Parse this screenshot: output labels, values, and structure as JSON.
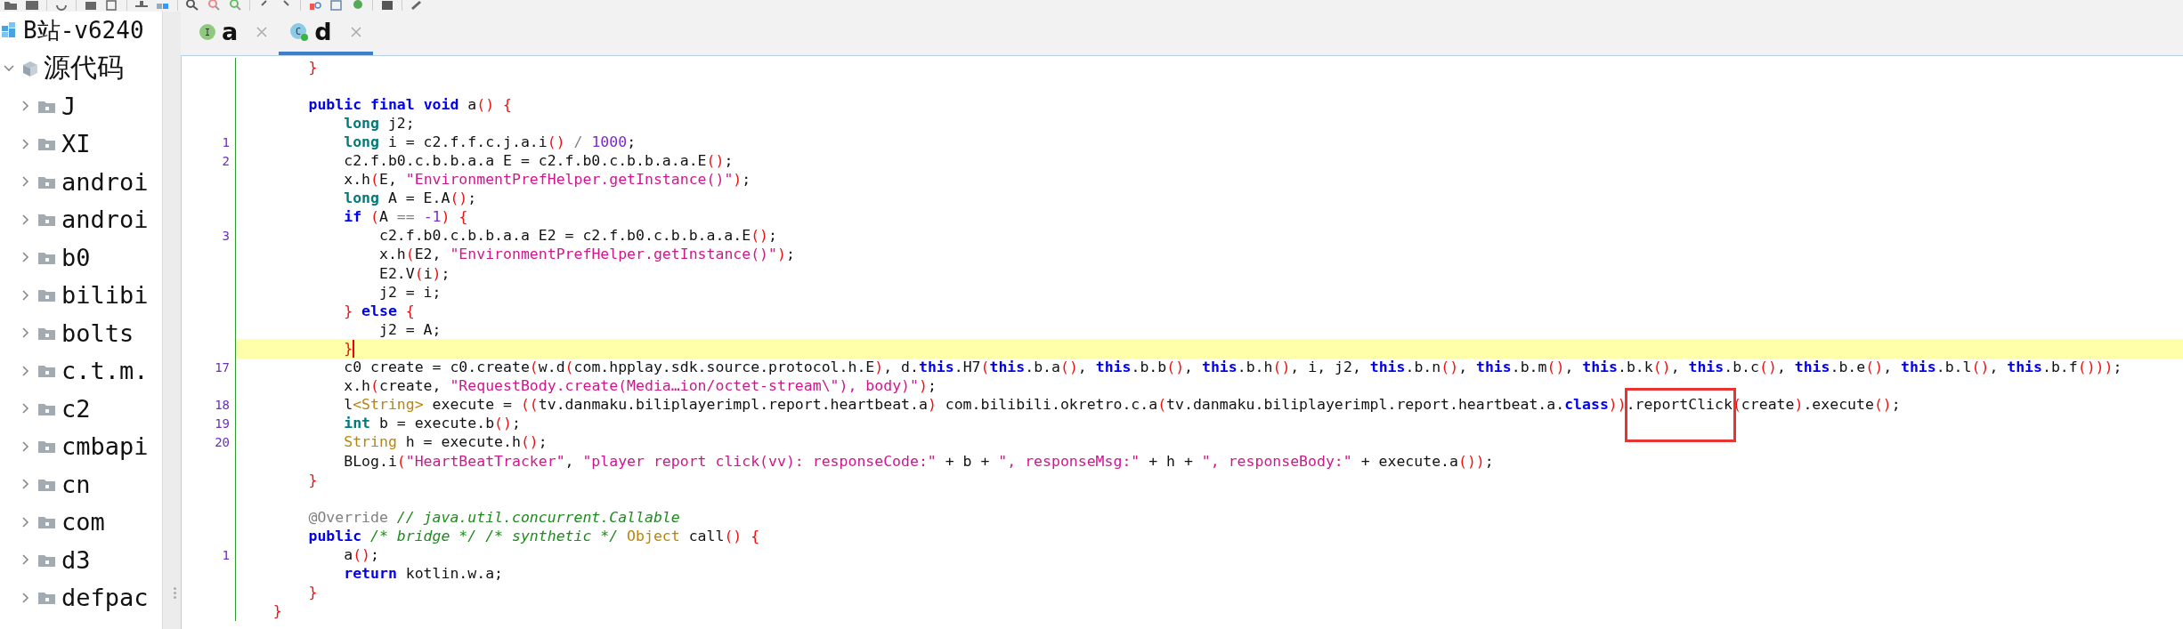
{
  "project_tree": {
    "label": "B站-v6240",
    "children": [
      {
        "label": "源代码",
        "expanded": true,
        "children": [
          {
            "label": "J",
            "expanded": false
          },
          {
            "label": "XI",
            "expanded": false
          },
          {
            "label": "androi",
            "expanded": false
          },
          {
            "label": "androi",
            "expanded": false
          },
          {
            "label": "b0",
            "expanded": false
          },
          {
            "label": "bilibi",
            "expanded": false
          },
          {
            "label": "bolts",
            "expanded": false
          },
          {
            "label": "c.t.m.",
            "expanded": false
          },
          {
            "label": "c2",
            "expanded": false
          },
          {
            "label": "cmbapi",
            "expanded": false
          },
          {
            "label": "cn",
            "expanded": false
          },
          {
            "label": "com",
            "expanded": false
          },
          {
            "label": "d3",
            "expanded": false
          },
          {
            "label": "defpac",
            "expanded": false
          }
        ]
      }
    ]
  },
  "tabs": [
    {
      "label": "a",
      "kind": "interface",
      "icon_letter": "I",
      "selected": false
    },
    {
      "label": "d",
      "kind": "class",
      "icon_letter": "C",
      "selected": true
    }
  ],
  "editor": {
    "lines": [
      {
        "tokens": [
          {
            "kind": "punc",
            "text": "        }"
          }
        ]
      },
      {
        "blank_line_before": true,
        "tokens": [
          {
            "kind": "kw",
            "text": "        public "
          },
          {
            "kind": "kw",
            "text": "final "
          },
          {
            "kind": "kw",
            "text": "void"
          },
          {
            "kind": "plain",
            "text": " a"
          },
          {
            "kind": "punc",
            "text": "() {"
          }
        ]
      },
      {
        "tokens": [
          {
            "kind": "type",
            "text": "            long"
          },
          {
            "kind": "plain",
            "text": " j2;"
          }
        ]
      },
      {
        "number": "1",
        "tokens": [
          {
            "kind": "type",
            "text": "            long"
          },
          {
            "kind": "plain",
            "text": " i = c2.f.f.c.j.a.i"
          },
          {
            "kind": "punc",
            "text": "()"
          },
          {
            "kind": "op",
            "text": " / "
          },
          {
            "kind": "num",
            "text": "1000"
          },
          {
            "kind": "plain",
            "text": ";"
          }
        ]
      },
      {
        "number": "2",
        "tokens": [
          {
            "kind": "plain",
            "text": "            c2.f.b0.c.b.b.a.a E = c2.f.b0.c.b.b.a.a.E"
          },
          {
            "kind": "punc",
            "text": "()"
          },
          {
            "kind": "plain",
            "text": ";"
          }
        ]
      },
      {
        "tokens": [
          {
            "kind": "plain",
            "text": "            x.h"
          },
          {
            "kind": "punc",
            "text": "("
          },
          {
            "kind": "plain",
            "text": "E, "
          },
          {
            "kind": "str",
            "text": "\"EnvironmentPrefHelper.getInstance()\""
          },
          {
            "kind": "punc",
            "text": ")"
          },
          {
            "kind": "plain",
            "text": ";"
          }
        ]
      },
      {
        "tokens": [
          {
            "kind": "type",
            "text": "            long"
          },
          {
            "kind": "plain",
            "text": " A = E.A"
          },
          {
            "kind": "punc",
            "text": "()"
          },
          {
            "kind": "plain",
            "text": ";"
          }
        ]
      },
      {
        "tokens": [
          {
            "kind": "kw",
            "text": "            if "
          },
          {
            "kind": "punc",
            "text": "("
          },
          {
            "kind": "plain",
            "text": "A "
          },
          {
            "kind": "op",
            "text": "== "
          },
          {
            "kind": "num",
            "text": "-1"
          },
          {
            "kind": "punc",
            "text": ") {"
          }
        ]
      },
      {
        "number": "3",
        "tokens": [
          {
            "kind": "plain",
            "text": "                c2.f.b0.c.b.b.a.a E2 = c2.f.b0.c.b.b.a.a.E"
          },
          {
            "kind": "punc",
            "text": "()"
          },
          {
            "kind": "plain",
            "text": ";"
          }
        ]
      },
      {
        "tokens": [
          {
            "kind": "plain",
            "text": "                x.h"
          },
          {
            "kind": "punc",
            "text": "("
          },
          {
            "kind": "plain",
            "text": "E2, "
          },
          {
            "kind": "str",
            "text": "\"EnvironmentPrefHelper.getInstance()\""
          },
          {
            "kind": "punc",
            "text": ")"
          },
          {
            "kind": "plain",
            "text": ";"
          }
        ]
      },
      {
        "tokens": [
          {
            "kind": "plain",
            "text": "                E2.V"
          },
          {
            "kind": "punc",
            "text": "("
          },
          {
            "kind": "plain",
            "text": "i"
          },
          {
            "kind": "punc",
            "text": ")"
          },
          {
            "kind": "plain",
            "text": ";"
          }
        ]
      },
      {
        "tokens": [
          {
            "kind": "plain",
            "text": "                j2 = i;"
          }
        ]
      },
      {
        "tokens": [
          {
            "kind": "punc",
            "text": "            } "
          },
          {
            "kind": "kw",
            "text": "else "
          },
          {
            "kind": "punc",
            "text": "{"
          }
        ]
      },
      {
        "tokens": [
          {
            "kind": "plain",
            "text": "                j2 = A;"
          }
        ]
      },
      {
        "current": true,
        "tokens": [
          {
            "kind": "punc",
            "text": "            }"
          }
        ]
      },
      {
        "number": "17",
        "tokens": [
          {
            "kind": "plain",
            "text": "            c0 create = c0.create"
          },
          {
            "kind": "punc",
            "text": "("
          },
          {
            "kind": "plain",
            "text": "w.d"
          },
          {
            "kind": "punc",
            "text": "("
          },
          {
            "kind": "plain",
            "text": "com.hpplay.sdk.source.protocol.h.E"
          },
          {
            "kind": "punc",
            "text": ")"
          },
          {
            "kind": "plain",
            "text": ", d."
          },
          {
            "kind": "kw",
            "text": "this"
          },
          {
            "kind": "plain",
            "text": ".H7"
          },
          {
            "kind": "punc",
            "text": "("
          },
          {
            "kind": "kw",
            "text": "this"
          },
          {
            "kind": "plain",
            "text": ".b.a"
          },
          {
            "kind": "punc",
            "text": "()"
          },
          {
            "kind": "plain",
            "text": ", "
          },
          {
            "kind": "kw",
            "text": "this"
          },
          {
            "kind": "plain",
            "text": ".b.b"
          },
          {
            "kind": "punc",
            "text": "()"
          },
          {
            "kind": "plain",
            "text": ", "
          },
          {
            "kind": "kw",
            "text": "this"
          },
          {
            "kind": "plain",
            "text": ".b.h"
          },
          {
            "kind": "punc",
            "text": "()"
          },
          {
            "kind": "plain",
            "text": ", i, j2, "
          },
          {
            "kind": "kw",
            "text": "this"
          },
          {
            "kind": "plain",
            "text": ".b.n"
          },
          {
            "kind": "punc",
            "text": "()"
          },
          {
            "kind": "plain",
            "text": ", "
          },
          {
            "kind": "kw",
            "text": "this"
          },
          {
            "kind": "plain",
            "text": ".b.m"
          },
          {
            "kind": "punc",
            "text": "()"
          },
          {
            "kind": "plain",
            "text": ", "
          },
          {
            "kind": "kw",
            "text": "this"
          },
          {
            "kind": "plain",
            "text": ".b.k"
          },
          {
            "kind": "punc",
            "text": "()"
          },
          {
            "kind": "plain",
            "text": ", "
          },
          {
            "kind": "kw",
            "text": "this"
          },
          {
            "kind": "plain",
            "text": ".b.c"
          },
          {
            "kind": "punc",
            "text": "()"
          },
          {
            "kind": "plain",
            "text": ", "
          },
          {
            "kind": "kw",
            "text": "this"
          },
          {
            "kind": "plain",
            "text": ".b.e"
          },
          {
            "kind": "punc",
            "text": "()"
          },
          {
            "kind": "plain",
            "text": ", "
          },
          {
            "kind": "kw",
            "text": "this"
          },
          {
            "kind": "plain",
            "text": ".b.l"
          },
          {
            "kind": "punc",
            "text": "()"
          },
          {
            "kind": "plain",
            "text": ", "
          },
          {
            "kind": "kw",
            "text": "this"
          },
          {
            "kind": "plain",
            "text": ".b.f"
          },
          {
            "kind": "punc",
            "text": "()))"
          },
          {
            "kind": "plain",
            "text": ";"
          }
        ]
      },
      {
        "tokens": [
          {
            "kind": "plain",
            "text": "            x.h"
          },
          {
            "kind": "punc",
            "text": "("
          },
          {
            "kind": "plain",
            "text": "create, "
          },
          {
            "kind": "str",
            "text": "\"RequestBody.create(Media…ion/octet-stream\\\"), body)\""
          },
          {
            "kind": "punc",
            "text": ")"
          },
          {
            "kind": "plain",
            "text": ";"
          }
        ]
      },
      {
        "number": "18",
        "tokens": [
          {
            "kind": "plain",
            "text": "            l"
          },
          {
            "kind": "cls",
            "text": "<String>"
          },
          {
            "kind": "plain",
            "text": " execute = "
          },
          {
            "kind": "punc",
            "text": "(("
          },
          {
            "kind": "plain",
            "text": "tv.danmaku.biliplayerimpl.report.heartbeat.a"
          },
          {
            "kind": "punc",
            "text": ")"
          },
          {
            "kind": "plain",
            "text": " com.bilibili.okretro.c.a"
          },
          {
            "kind": "punc",
            "text": "("
          },
          {
            "kind": "plain",
            "text": "tv.danmaku.biliplayerimpl.report.heartbeat.a."
          },
          {
            "kind": "kw",
            "text": "class"
          },
          {
            "kind": "punc",
            "text": "))"
          },
          {
            "kind": "plain",
            "text": ".reportClick",
            "boxed": true
          },
          {
            "kind": "punc",
            "text": "("
          },
          {
            "kind": "plain",
            "text": "create"
          },
          {
            "kind": "punc",
            "text": ")"
          },
          {
            "kind": "plain",
            "text": ".execute"
          },
          {
            "kind": "punc",
            "text": "()"
          },
          {
            "kind": "plain",
            "text": ";"
          }
        ]
      },
      {
        "number": "19",
        "tokens": [
          {
            "kind": "type",
            "text": "            int"
          },
          {
            "kind": "plain",
            "text": " b = execute.b"
          },
          {
            "kind": "punc",
            "text": "()"
          },
          {
            "kind": "plain",
            "text": ";"
          }
        ]
      },
      {
        "number": "20",
        "tokens": [
          {
            "kind": "cls",
            "text": "            String"
          },
          {
            "kind": "plain",
            "text": " h = execute.h"
          },
          {
            "kind": "punc",
            "text": "()"
          },
          {
            "kind": "plain",
            "text": ";"
          }
        ]
      },
      {
        "tokens": [
          {
            "kind": "plain",
            "text": "            BLog.i"
          },
          {
            "kind": "punc",
            "text": "("
          },
          {
            "kind": "str",
            "text": "\"HeartBeatTracker\""
          },
          {
            "kind": "plain",
            "text": ", "
          },
          {
            "kind": "str",
            "text": "\"player report click(vv): responseCode:\""
          },
          {
            "kind": "plain",
            "text": " + b + "
          },
          {
            "kind": "str",
            "text": "\", responseMsg:\""
          },
          {
            "kind": "plain",
            "text": " + h + "
          },
          {
            "kind": "str",
            "text": "\", responseBody:\""
          },
          {
            "kind": "plain",
            "text": " + execute.a"
          },
          {
            "kind": "punc",
            "text": "())"
          },
          {
            "kind": "plain",
            "text": ";"
          }
        ]
      },
      {
        "tokens": [
          {
            "kind": "punc",
            "text": "        }"
          }
        ]
      },
      {
        "blank_line_before": true,
        "tokens": [
          {
            "kind": "ann",
            "text": "        @Override "
          },
          {
            "kind": "cmt",
            "text": "// java.util.concurrent.Callable"
          }
        ]
      },
      {
        "tokens": [
          {
            "kind": "kw",
            "text": "        public "
          },
          {
            "kind": "cmt",
            "text": "/* bridge */ "
          },
          {
            "kind": "cmt",
            "text": "/* synthetic */ "
          },
          {
            "kind": "cls",
            "text": "Object"
          },
          {
            "kind": "plain",
            "text": " call"
          },
          {
            "kind": "punc",
            "text": "() {"
          }
        ]
      },
      {
        "number": "1",
        "tokens": [
          {
            "kind": "plain",
            "text": "            a"
          },
          {
            "kind": "punc",
            "text": "()"
          },
          {
            "kind": "plain",
            "text": ";"
          }
        ]
      },
      {
        "tokens": [
          {
            "kind": "kw",
            "text": "            return"
          },
          {
            "kind": "plain",
            "text": " kotlin.w.a;"
          }
        ]
      },
      {
        "tokens": [
          {
            "kind": "punc",
            "text": "        }"
          }
        ]
      },
      {
        "tokens": [
          {
            "kind": "punc",
            "text": "    }"
          }
        ]
      }
    ]
  }
}
